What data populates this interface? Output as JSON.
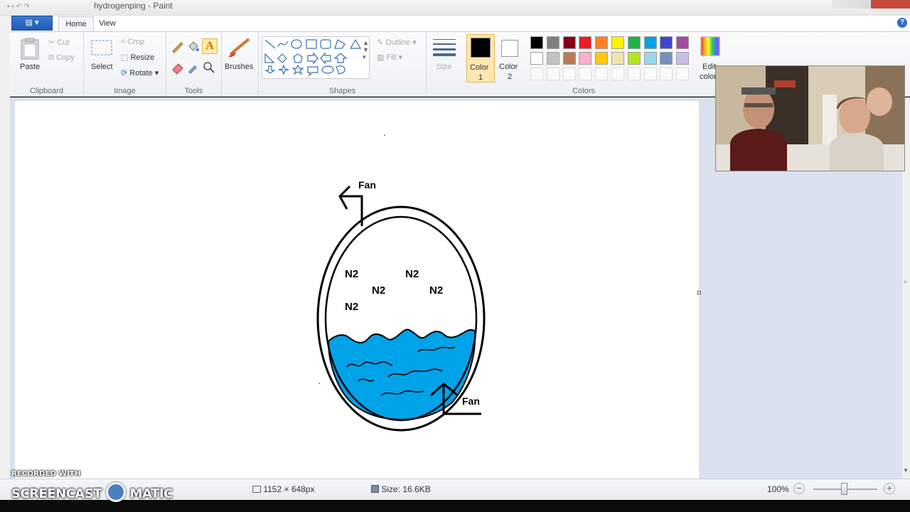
{
  "window": {
    "title": "hydrogenping - Paint"
  },
  "ribbon": {
    "app_menu_label": "▤ ▾",
    "tabs": [
      {
        "label": "Home"
      },
      {
        "label": "View"
      }
    ],
    "clipboard": {
      "paste": "Paste",
      "cut": "Cut",
      "copy": "Copy",
      "group": "Clipboard"
    },
    "image": {
      "select": "Select",
      "crop": "Crop",
      "resize": "Resize",
      "rotate": "Rotate",
      "group": "Image"
    },
    "tools": {
      "group": "Tools"
    },
    "brushes": {
      "label": "Brushes"
    },
    "shapes": {
      "outline": "Outline",
      "fill": "Fill",
      "group": "Shapes"
    },
    "size": {
      "label": "Size"
    },
    "colors": {
      "color1_label_a": "Color",
      "color1_label_b": "1",
      "color2_label_a": "Color",
      "color2_label_b": "2",
      "edit_a": "Edit",
      "edit_b": "colors",
      "group": "Colors",
      "color1": "#000000",
      "color2": "#ffffff",
      "palette_row1": [
        "#000000",
        "#7f7f7f",
        "#880015",
        "#ed1c24",
        "#ff7f27",
        "#fff200",
        "#22b14c",
        "#00a2e8",
        "#3f48cc",
        "#a349a4"
      ],
      "palette_row2": [
        "#ffffff",
        "#c3c3c3",
        "#b97a57",
        "#ffaec9",
        "#ffc90e",
        "#efe4b0",
        "#b5e61d",
        "#99d9ea",
        "#7092be",
        "#c8bfe7"
      ]
    }
  },
  "drawing": {
    "fan_top": "Fan",
    "fan_bottom": "Fan",
    "gas_labels": [
      "N2",
      "N2",
      "N2",
      "N2",
      "N2"
    ],
    "water_color": "#00a2e8"
  },
  "status": {
    "dimensions": "1152 × 648px",
    "size": "Size: 16.6KB",
    "zoom": "100%"
  },
  "watermark": {
    "line1": "RECORDED WITH",
    "line2a": "SCREENCAST",
    "line2b": "MATIC"
  }
}
